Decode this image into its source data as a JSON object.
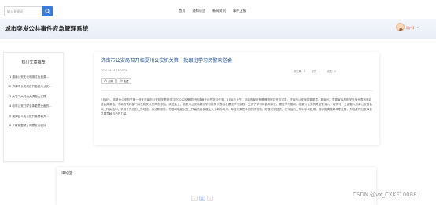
{
  "search": {
    "placeholder": "输入关键词"
  },
  "nav": [
    "首页",
    "通知公告",
    "新闻资讯",
    "事件上报"
  ],
  "site_title": "城市突发公共事件应急管理系统",
  "user": {
    "name": "用户1"
  },
  "left_panel": {
    "title": "热门文章推荐",
    "items": [
      "1 湖南公安无论利用红色资源...",
      "2 济南市公安局召开临夏州公安...",
      "3 大学习大讨论大调查大实践...",
      "4 动车公安打好总体更是全面的...",
      "5 湖源县人民法院开展警城大...",
      "6 「教育整顿」内蒙古公安厅..."
    ]
  },
  "article": {
    "title": "济南市公安局召开临夏州公安机关第一批跟班学习民警欢送会",
    "date": "2024-06-04 16:28:29",
    "views": "浏览量：1",
    "likes": "点赞：1",
    "collects": "收藏：0",
    "like_label": "点赞",
    "fav_label": "收藏",
    "body": "5月8日，临夏州公安机关第一批来济南市公安机关跟班学习的30名民警顺利完成两个月的学习任务。5月8日上午，济南市局在警察博物馆召开欢送会，济南市公安局党委委员、副局长、党委宣传部相关处室代表出席欢送会并讲话，市局各警种部门以及相关负责同志参加。欢送会上，临夏州公安局跟班学习民警代表结合跟班学习实践，交流了学习体会和收获。跟班学习期间，临夏州公安机关民警深入一线学习，全面融入济南公安的各项工作实践中，学到了先进的工作理念、方法和经验，为推动临夏公安工作高质量发展注入了新的动力。希望大家把学到的好经验、好做法带回去，在今后的工作中学以致用，用心用情做好本职工作，为临夏州公安事业发展贡献自己的力量。"
  },
  "comment": {
    "title": "评论区",
    "pager": [
      "‹",
      "1",
      "›"
    ]
  },
  "watermark": "CSDN @vx_CXKF10088",
  "colors": {
    "accent": "#3a7be0",
    "title_blue": "#1f4f9a",
    "user_red": "#e04a3a"
  },
  "icons": [
    "search-icon",
    "thumb-up-icon",
    "star-icon",
    "chevron-down-icon"
  ]
}
